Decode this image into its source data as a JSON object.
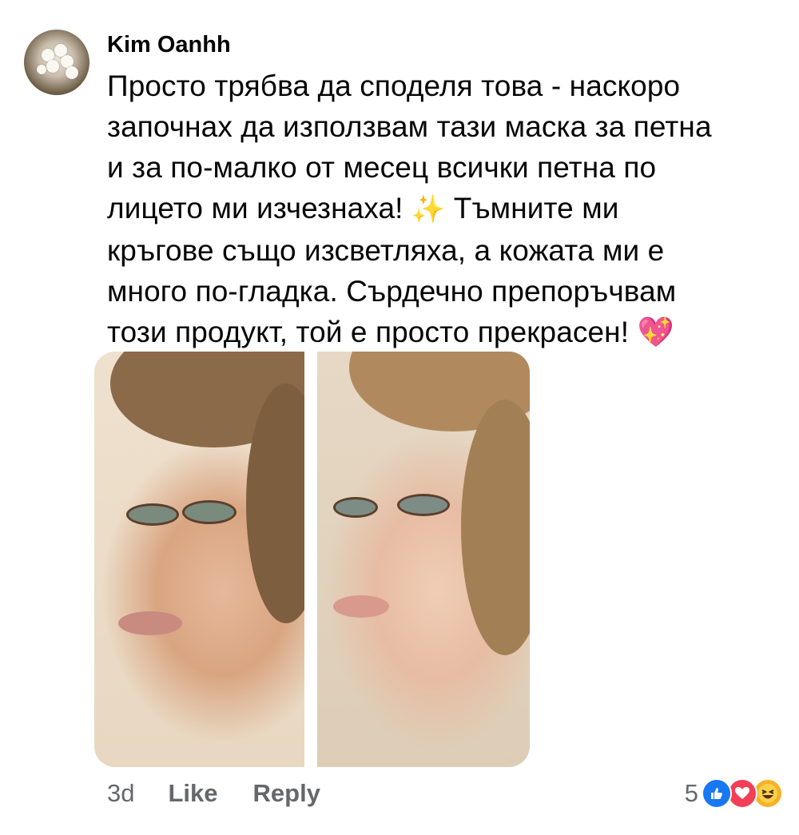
{
  "comment": {
    "author": "Kim Oanhh",
    "lines": [
      "Просто трябва да споделя това - наскоро",
      "започнах да използвам тази маска за петна",
      "и за по-малко от месец всички петна по",
      "лицето ми изчезнаха!",
      "Тъмните ми",
      "кръгове също изсветляха, а кожата ми е",
      "много по-гладка. Сърдечно препоръчвам",
      "този продукт, той е просто прекрасен!"
    ],
    "emoji_sparkles": "✨",
    "emoji_heart": "💖",
    "timestamp": "3d",
    "like_label": "Like",
    "reply_label": "Reply",
    "reaction_count": "5"
  },
  "icons": {
    "like": "thumbs-up-icon",
    "love": "heart-icon",
    "haha": "laughing-face-icon"
  },
  "colors": {
    "like_blue": "#1877f2",
    "love_red": "#f33e58",
    "haha_yellow": "#f7b125",
    "meta_gray": "#65676b"
  }
}
